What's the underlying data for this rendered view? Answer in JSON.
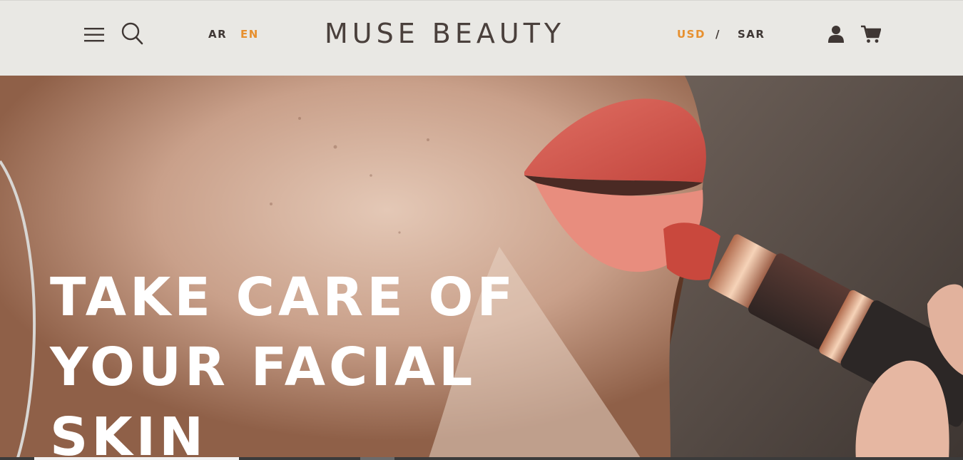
{
  "header": {
    "languages": {
      "ar": "AR",
      "en": "EN",
      "active": "EN"
    },
    "logo": "MUSE BEAUTY",
    "currency": {
      "usd": "USD",
      "separator": "/",
      "sar": "SAR",
      "active": "USD"
    },
    "icons": [
      "menu-icon",
      "search-icon",
      "user-icon",
      "cart-icon"
    ]
  },
  "hero": {
    "title_lines": [
      "TAKE CARE OF",
      "YOUR FACIAL",
      "SKIN"
    ]
  },
  "colors": {
    "accent": "#e7902f",
    "text_dark": "#3f3734",
    "header_bg": "#e9e8e4"
  }
}
